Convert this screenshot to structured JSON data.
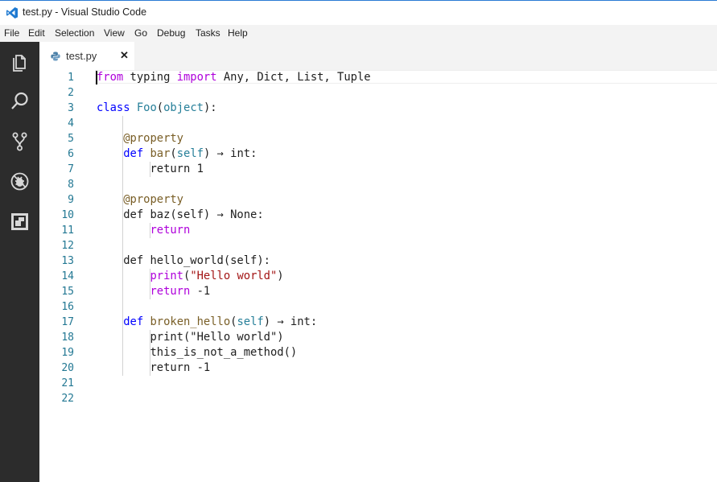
{
  "window": {
    "title": "test.py - Visual Studio Code"
  },
  "menu": [
    "File",
    "Edit",
    "Selection",
    "View",
    "Go",
    "Debug",
    "Tasks",
    "Help"
  ],
  "activity_bar": [
    "explorer-icon",
    "search-icon",
    "source-control-icon",
    "debug-icon",
    "extensions-icon"
  ],
  "tab": {
    "filename": "test.py",
    "close": "✕"
  },
  "editor": {
    "line_numbers": [
      "1",
      "2",
      "3",
      "4",
      "5",
      "6",
      "7",
      "8",
      "9",
      "10",
      "11",
      "12",
      "13",
      "14",
      "15",
      "16",
      "17",
      "18",
      "19",
      "20",
      "21",
      "22"
    ],
    "lines": [
      [
        {
          "t": "from",
          "c": "kw2"
        },
        {
          "t": " typing "
        },
        {
          "t": "import",
          "c": "kw2"
        },
        {
          "t": " Any, Dict, List, Tuple"
        }
      ],
      [],
      [
        {
          "t": "class",
          "c": "kw"
        },
        {
          "t": " "
        },
        {
          "t": "Foo",
          "c": "cls"
        },
        {
          "t": "("
        },
        {
          "t": "object",
          "c": "cls"
        },
        {
          "t": "):"
        }
      ],
      [],
      [
        {
          "t": "    "
        },
        {
          "t": "@property",
          "c": "dec"
        }
      ],
      [
        {
          "t": "    "
        },
        {
          "t": "def",
          "c": "kw"
        },
        {
          "t": " "
        },
        {
          "t": "bar",
          "c": "dec"
        },
        {
          "t": "("
        },
        {
          "t": "self",
          "c": "cls"
        },
        {
          "t": ") → int:"
        }
      ],
      [
        {
          "t": "        return 1"
        }
      ],
      [],
      [
        {
          "t": "    "
        },
        {
          "t": "@property",
          "c": "dec"
        }
      ],
      [
        {
          "t": "    def baz(self) → None:"
        }
      ],
      [
        {
          "t": "        "
        },
        {
          "t": "return",
          "c": "kw2"
        }
      ],
      [],
      [
        {
          "t": "    def hello_world(self):"
        }
      ],
      [
        {
          "t": "        "
        },
        {
          "t": "print",
          "c": "kw2"
        },
        {
          "t": "("
        },
        {
          "t": "\"Hello world\"",
          "c": "str"
        },
        {
          "t": ")"
        }
      ],
      [
        {
          "t": "        "
        },
        {
          "t": "return",
          "c": "kw2"
        },
        {
          "t": " -1"
        }
      ],
      [],
      [
        {
          "t": "    "
        },
        {
          "t": "def",
          "c": "kw"
        },
        {
          "t": " "
        },
        {
          "t": "broken_hello",
          "c": "dec"
        },
        {
          "t": "("
        },
        {
          "t": "self",
          "c": "cls"
        },
        {
          "t": ") → int:"
        }
      ],
      [
        {
          "t": "        print(\"Hello world\")"
        }
      ],
      [
        {
          "t": "        this_is_not_a_method()"
        }
      ],
      [
        {
          "t": "        return -1"
        }
      ],
      [],
      []
    ]
  }
}
